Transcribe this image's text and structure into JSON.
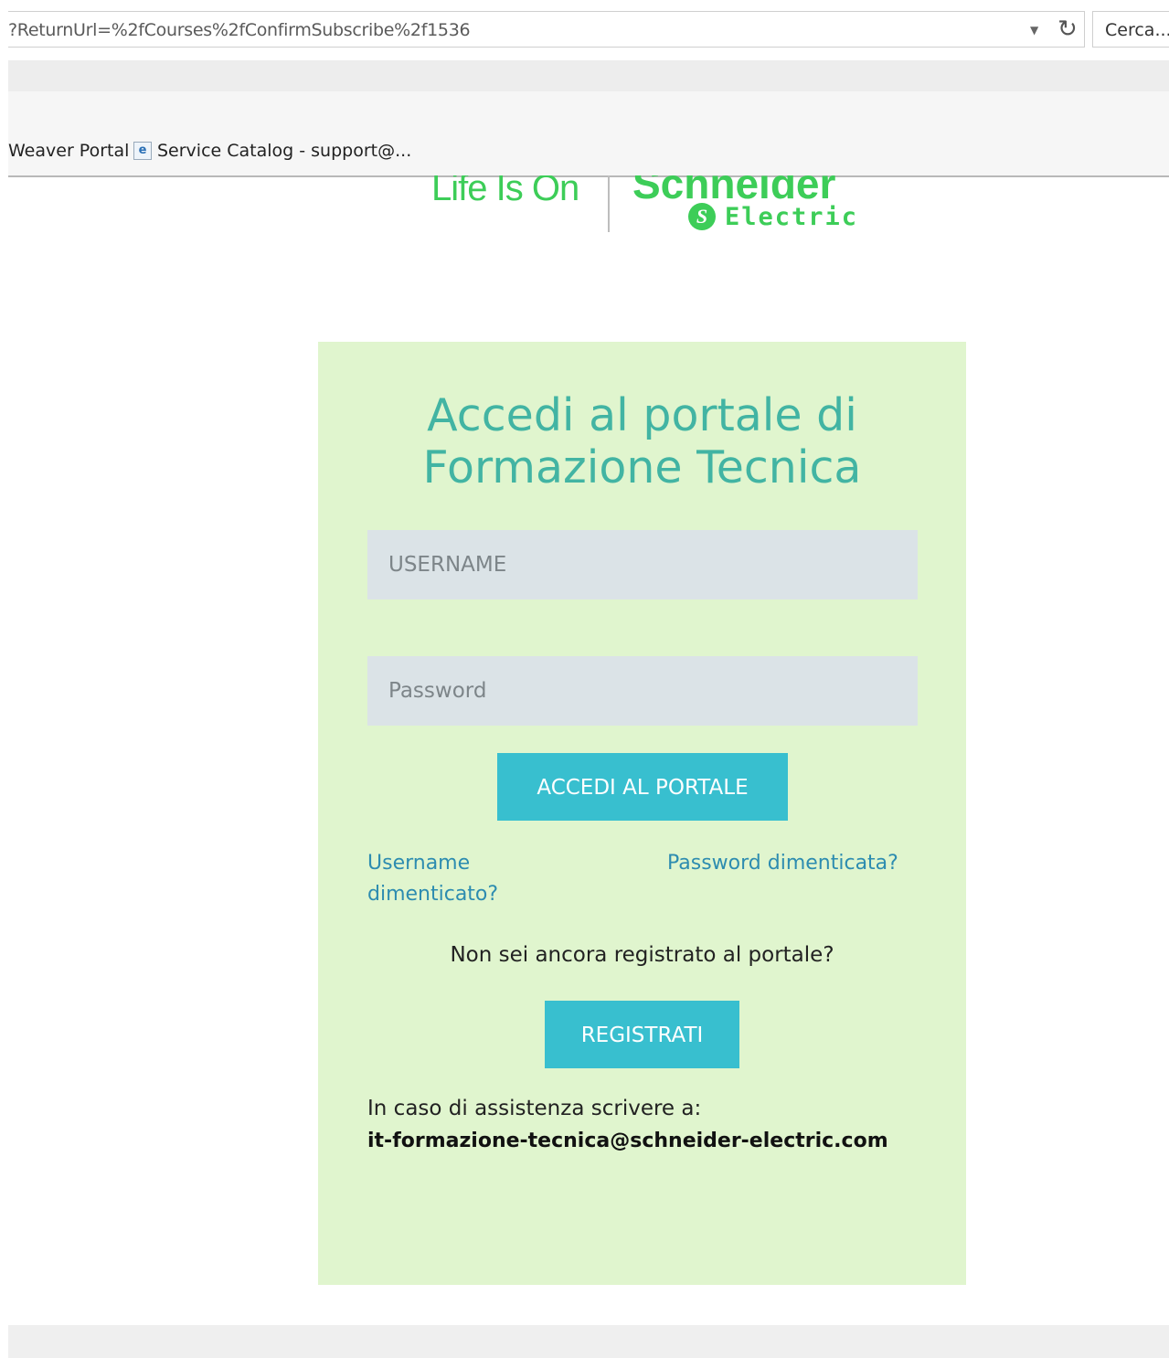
{
  "browser": {
    "url": "?ReturnUrl=%2fCourses%2fConfirmSubscribe%2f1536",
    "search_placeholder": "Cerca...",
    "favorites": [
      {
        "label": "Weaver Portal"
      },
      {
        "label": "Service Catalog - support@..."
      }
    ]
  },
  "logo": {
    "tagline": "Life Is On",
    "brand_name": "Schneider",
    "brand_sub": "Electric"
  },
  "login": {
    "title_line1": "Accedi al portale di",
    "title_line2": "Formazione Tecnica",
    "username_placeholder": "USERNAME",
    "password_placeholder": "Password",
    "login_button": "ACCEDI AL PORTALE",
    "forgot_username": "Username dimenticato?",
    "forgot_password": "Password dimenticata?",
    "register_prompt": "Non sei ancora registrato al portale?",
    "register_button": "REGISTRATI",
    "support_text": "In caso di assistenza scrivere a:",
    "support_email": "it-formazione-tecnica@schneider-electric.com"
  },
  "colors": {
    "brand_green": "#3dcd58",
    "card_background": "#e0f5ce",
    "title_teal": "#42b4a3",
    "button_cyan": "#38bfcf",
    "link_blue": "#2d8cb0"
  }
}
